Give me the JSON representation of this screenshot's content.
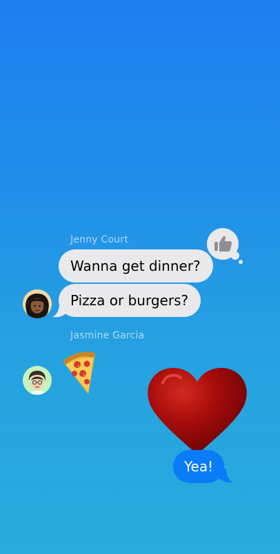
{
  "conversation": {
    "groups": [
      {
        "sender": "Jenny Court",
        "messages": [
          "Wanna get dinner?",
          "Pizza or burgers?"
        ],
        "reaction": "thumbs-up-icon"
      },
      {
        "sender": "Jasmine Garcia",
        "sticker": "pizza-slice-icon"
      }
    ],
    "outgoing": {
      "sticker": "heart-icon",
      "message": "Yea!"
    }
  },
  "colors": {
    "incoming_bubble": "#e9e9eb",
    "outgoing_bubble": "#0a7cf7",
    "background_top": "#1d7ff2",
    "background_bottom": "#28acdc"
  }
}
